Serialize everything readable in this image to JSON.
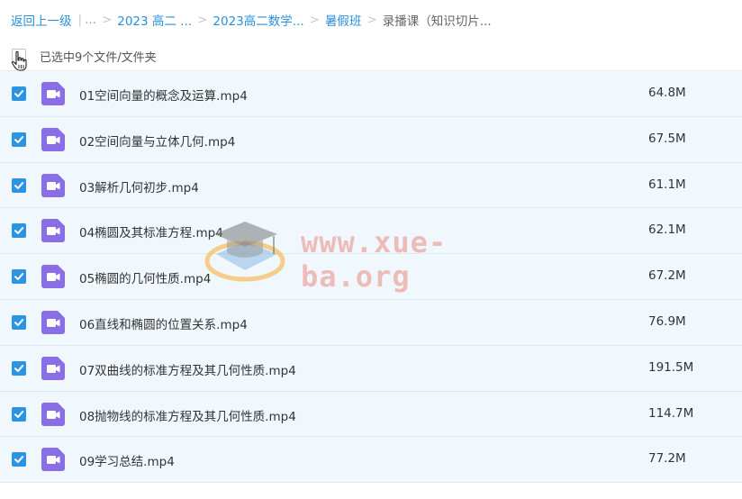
{
  "breadcrumb": {
    "back": "返回上一级",
    "back_ellipsis": "...",
    "items": [
      "2023 高二 ...",
      "2023高二数学...",
      "暑假班"
    ],
    "current": "录播课（知识切片..."
  },
  "selection": {
    "label": "已选中9个文件/文件夹"
  },
  "colors": {
    "accent": "#2b94e3",
    "row_bg": "#f1f8fd",
    "video_icon": "#8a6ee6"
  },
  "files": [
    {
      "name": "01空间向量的概念及运算.mp4",
      "size": "64.8M",
      "icon": "video-file-icon"
    },
    {
      "name": "02空间向量与立体几何.mp4",
      "size": "67.5M",
      "icon": "video-file-icon"
    },
    {
      "name": "03解析几何初步.mp4",
      "size": "61.1M",
      "icon": "video-file-icon"
    },
    {
      "name": "04椭圆及其标准方程.mp4",
      "size": "62.1M",
      "icon": "video-file-icon"
    },
    {
      "name": "05椭圆的几何性质.mp4",
      "size": "67.2M",
      "icon": "video-file-icon"
    },
    {
      "name": "06直线和椭圆的位置关系.mp4",
      "size": "76.9M",
      "icon": "video-file-icon"
    },
    {
      "name": "07双曲线的标准方程及其几何性质.mp4",
      "size": "191.5M",
      "icon": "video-file-icon"
    },
    {
      "name": "08抛物线的标准方程及其几何性质.mp4",
      "size": "114.7M",
      "icon": "video-file-icon"
    },
    {
      "name": "09学习总结.mp4",
      "size": "77.2M",
      "icon": "video-file-icon"
    }
  ],
  "watermark": {
    "text": "www.xue-ba.org"
  }
}
